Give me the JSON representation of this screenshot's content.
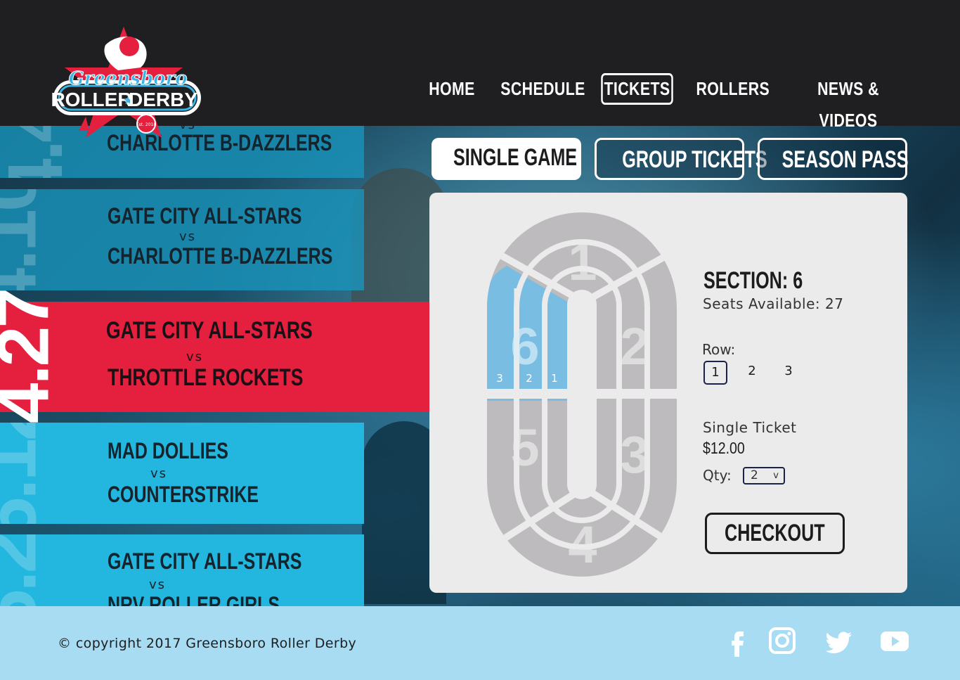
{
  "header": {
    "logo": {
      "line1": "Greensboro",
      "line2": "ROLLER",
      "line3": "DERBY",
      "badge": "Est. 2010"
    },
    "nav": [
      {
        "label": "HOME",
        "active": false
      },
      {
        "label": "SCHEDULE",
        "active": false
      },
      {
        "label": "TICKETS",
        "active": true
      },
      {
        "label": "ROLLERS",
        "active": false
      },
      {
        "label": "NEWS & VIDEOS",
        "active": false
      }
    ]
  },
  "events": [
    {
      "date": "4.4",
      "team1": "",
      "vs": "vs",
      "team2": "CHARLOTTE B-DAZZLERS"
    },
    {
      "date": "4.10",
      "team1": "GATE CITY ALL-STARS",
      "vs": "vs",
      "team2": "CHARLOTTE B-DAZZLERS"
    },
    {
      "date": "4.27",
      "team1": "GATE CITY ALL-STARS",
      "vs": "vs",
      "team2": "THROTTLE ROCKETS",
      "selected": true
    },
    {
      "date": "5.12",
      "team1": "MAD DOLLIES",
      "vs": "vs",
      "team2": "COUNTERSTRIKE"
    },
    {
      "date": "5.20",
      "team1": "GATE CITY ALL-STARS",
      "vs": "vs",
      "team2": "NRV ROLLER GIRLS"
    }
  ],
  "ticket_types": [
    {
      "label": "SINGLE GAME",
      "active": true
    },
    {
      "label": "GROUP TICKETS",
      "active": false
    },
    {
      "label": "SEASON PASS",
      "active": false
    }
  ],
  "track": {
    "sections": [
      "1",
      "2",
      "3",
      "4",
      "5",
      "6"
    ],
    "selected_section": "6",
    "row_labels": [
      "3",
      "2",
      "1"
    ]
  },
  "detail": {
    "section_title": "SECTION: 6",
    "seats_available": "Seats Available: 27",
    "row_label": "Row:",
    "rows": [
      "1",
      "2",
      "3"
    ],
    "selected_row": "1",
    "ticket_label": "Single Ticket",
    "price": "$12.00",
    "qty_label": "Qty:",
    "qty_value": "2",
    "qty_caret": "v",
    "checkout_label": "CHECKOUT"
  },
  "footer": {
    "copyright": "© copyright 2017 Greensboro Roller Derby",
    "social": [
      "facebook-icon",
      "instagram-icon",
      "twitter-icon",
      "youtube-icon"
    ]
  },
  "colors": {
    "header_bg": "#1f1f21",
    "accent_red": "#e5203f",
    "accent_blue": "#23b7df",
    "selected_section": "#79bde3",
    "footer_bg": "#a7dcf3"
  }
}
